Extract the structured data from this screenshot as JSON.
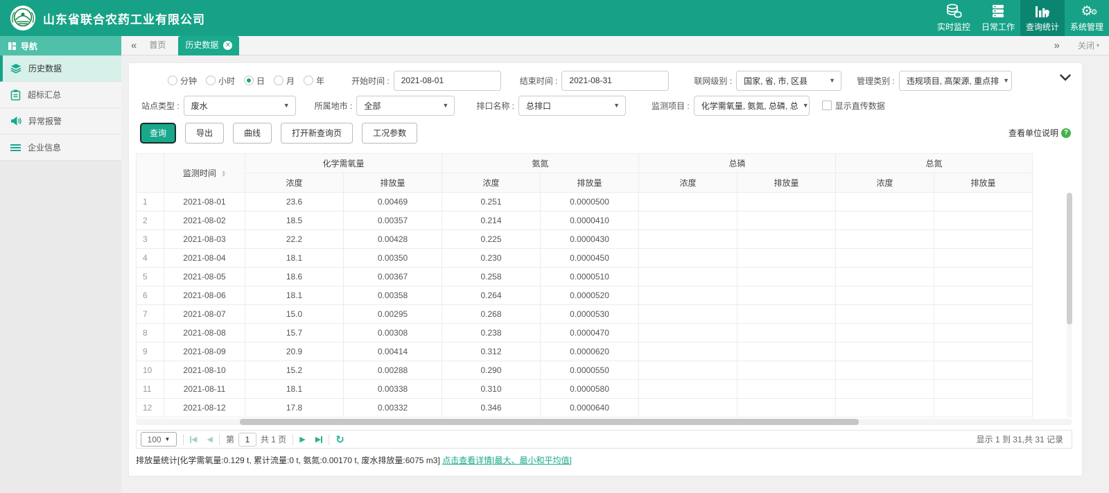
{
  "app": {
    "company": "山东省联合农药工业有限公司"
  },
  "topnav": {
    "items": [
      {
        "label": "实时监控"
      },
      {
        "label": "日常工作"
      },
      {
        "label": "查询统计"
      },
      {
        "label": "系统管理"
      }
    ]
  },
  "sidebar": {
    "title": "导航",
    "items": [
      {
        "label": "历史数据"
      },
      {
        "label": "超标汇总"
      },
      {
        "label": "异常报警"
      },
      {
        "label": "企业信息"
      }
    ]
  },
  "tabs": {
    "home": "首页",
    "active": "历史数据",
    "close": "关闭"
  },
  "filters": {
    "periods": [
      {
        "label": "分钟"
      },
      {
        "label": "小时"
      },
      {
        "label": "日"
      },
      {
        "label": "月"
      },
      {
        "label": "年"
      }
    ],
    "start_label": "开始时间 :",
    "start_value": "2021-08-01",
    "end_label": "结束时间 :",
    "end_value": "2021-08-31",
    "network_label": "联网级别 :",
    "network_value": "国家, 省, 市, 区县",
    "manage_label": "管理类别 :",
    "manage_value": "违规项目, 高架源, 重点排",
    "station_label": "站点类型 :",
    "station_value": "废水",
    "city_label": "所属地市 :",
    "city_value": "全部",
    "outlet_label": "排口名称 :",
    "outlet_value": "总排口",
    "items_label": "监测项目 :",
    "items_value": "化学需氧量, 氨氮, 总磷, 总",
    "direct_label": "显示直传数据"
  },
  "toolbar": {
    "query": "查询",
    "export": "导出",
    "curve": "曲线",
    "new_query": "打开新查询页",
    "params": "工况参数",
    "unit_help": "查看单位说明"
  },
  "table": {
    "time_header": "监测时间",
    "groups": [
      {
        "name": "化学需氧量"
      },
      {
        "name": "氨氮"
      },
      {
        "name": "总磷"
      },
      {
        "name": "总氮"
      }
    ],
    "sub_conc": "浓度",
    "sub_emis": "排放量",
    "rows": [
      {
        "num": "1",
        "date": "2021-08-01",
        "values": [
          "23.6",
          "0.00469",
          "0.251",
          "0.0000500",
          "",
          "",
          "",
          ""
        ]
      },
      {
        "num": "2",
        "date": "2021-08-02",
        "values": [
          "18.5",
          "0.00357",
          "0.214",
          "0.0000410",
          "",
          "",
          "",
          ""
        ]
      },
      {
        "num": "3",
        "date": "2021-08-03",
        "values": [
          "22.2",
          "0.00428",
          "0.225",
          "0.0000430",
          "",
          "",
          "",
          ""
        ]
      },
      {
        "num": "4",
        "date": "2021-08-04",
        "values": [
          "18.1",
          "0.00350",
          "0.230",
          "0.0000450",
          "",
          "",
          "",
          ""
        ]
      },
      {
        "num": "5",
        "date": "2021-08-05",
        "values": [
          "18.6",
          "0.00367",
          "0.258",
          "0.0000510",
          "",
          "",
          "",
          ""
        ]
      },
      {
        "num": "6",
        "date": "2021-08-06",
        "values": [
          "18.1",
          "0.00358",
          "0.264",
          "0.0000520",
          "",
          "",
          "",
          ""
        ]
      },
      {
        "num": "7",
        "date": "2021-08-07",
        "values": [
          "15.0",
          "0.00295",
          "0.268",
          "0.0000530",
          "",
          "",
          "",
          ""
        ]
      },
      {
        "num": "8",
        "date": "2021-08-08",
        "values": [
          "15.7",
          "0.00308",
          "0.238",
          "0.0000470",
          "",
          "",
          "",
          ""
        ]
      },
      {
        "num": "9",
        "date": "2021-08-09",
        "values": [
          "20.9",
          "0.00414",
          "0.312",
          "0.0000620",
          "",
          "",
          "",
          ""
        ]
      },
      {
        "num": "10",
        "date": "2021-08-10",
        "values": [
          "15.2",
          "0.00288",
          "0.290",
          "0.0000550",
          "",
          "",
          "",
          ""
        ]
      },
      {
        "num": "11",
        "date": "2021-08-11",
        "values": [
          "18.1",
          "0.00338",
          "0.310",
          "0.0000580",
          "",
          "",
          "",
          ""
        ]
      },
      {
        "num": "12",
        "date": "2021-08-12",
        "values": [
          "17.8",
          "0.00332",
          "0.346",
          "0.0000640",
          "",
          "",
          "",
          ""
        ]
      }
    ]
  },
  "pagination": {
    "page_size": "100",
    "page_prefix": "第",
    "page_value": "1",
    "page_suffix": "共 1 页",
    "summary": "显示 1 到 31,共 31 记录"
  },
  "stats": {
    "text": "排放量统计[化学需氧量:0.129 t, 累计流量:0 t, 氨氮:0.00170 t, 废水排放量:6075 m3] ",
    "link": "点击查看详情[最大、最小和平均值]"
  },
  "colors": {
    "brand": "#17a287",
    "brand_dark": "#0c8570",
    "brand_light": "#4fc0aa",
    "tab_active": "#1aa98d",
    "help_badge": "#43b24c"
  }
}
